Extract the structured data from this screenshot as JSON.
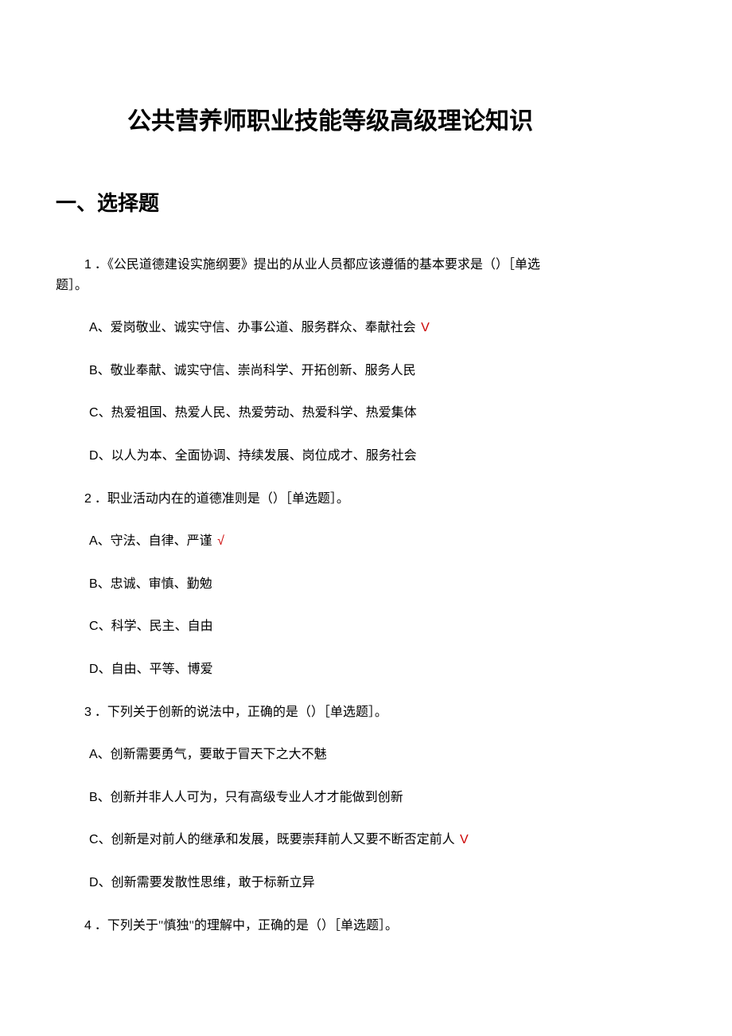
{
  "title": "公共营养师职业技能等级高级理论知识",
  "section_heading": "一、选择题",
  "questions": [
    {
      "num": "1",
      "text": "．《公民道德建设实施纲要》提出的从业人员都应该遵循的基本要求是（）［单选题］。",
      "wrap": true,
      "options": [
        {
          "letter": "A",
          "text": "、爱岗敬业、诚实守信、办事公道、服务群众、奉献社会",
          "correct": true,
          "mark": "V"
        },
        {
          "letter": "B",
          "text": "、敬业奉献、诚实守信、崇尚科学、开拓创新、服务人民",
          "correct": false
        },
        {
          "letter": "C",
          "text": "、热爱祖国、热爱人民、热爱劳动、热爱科学、热爱集体",
          "correct": false
        },
        {
          "letter": "D",
          "text": "、以人为本、全面协调、持续发展、岗位成才、服务社会",
          "correct": false
        }
      ]
    },
    {
      "num": "2",
      "text": "．职业活动内在的道德准则是（）［单选题］。",
      "options": [
        {
          "letter": "A",
          "text": "、守法、自律、严谨",
          "correct": true,
          "mark": "√"
        },
        {
          "letter": "B",
          "text": "、忠诚、审慎、勤勉",
          "correct": false
        },
        {
          "letter": "C",
          "text": "、科学、民主、自由",
          "correct": false
        },
        {
          "letter": "D",
          "text": "、自由、平等、博爱",
          "correct": false
        }
      ]
    },
    {
      "num": "3",
      "text": "．下列关于创新的说法中，正确的是（）［单选题］。",
      "options": [
        {
          "letter": "A",
          "text": "、创新需要勇气，要敢于冒天下之大不魅",
          "correct": false
        },
        {
          "letter": "B",
          "text": "、创新并非人人可为，只有高级专业人才才能做到创新",
          "correct": false
        },
        {
          "letter": "C",
          "text": "、创新是对前人的继承和发展，既要崇拜前人又要不断否定前人",
          "correct": true,
          "mark": "V"
        },
        {
          "letter": "D",
          "text": "、创新需要发散性思维，敢于标新立异",
          "correct": false
        }
      ]
    },
    {
      "num": "4",
      "text": "．下列关于\"慎独\"的理解中，正确的是（）［单选题］。",
      "options": []
    }
  ]
}
